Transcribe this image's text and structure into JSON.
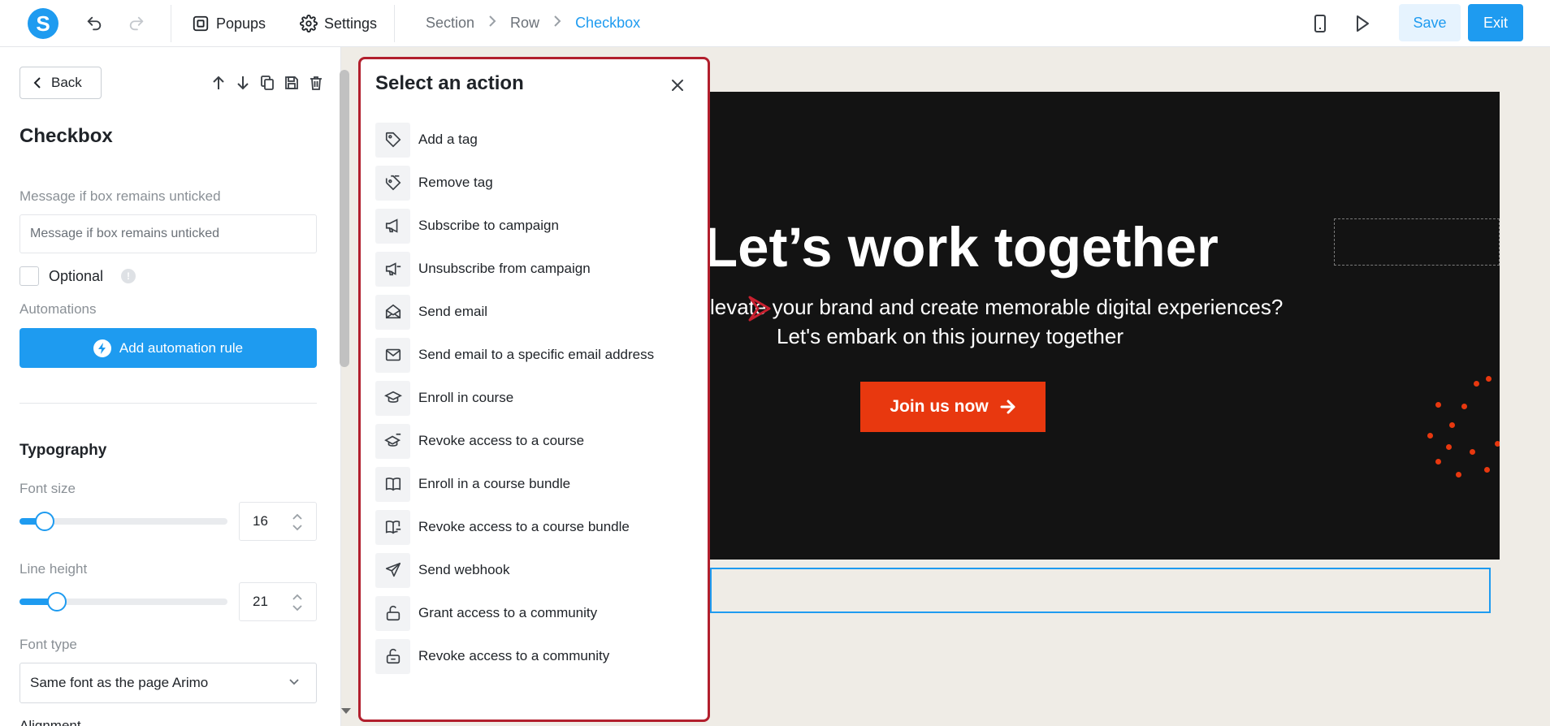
{
  "topbar": {
    "logo_letter": "S",
    "popups_label": "Popups",
    "settings_label": "Settings",
    "breadcrumb": [
      "Section",
      "Row",
      "Checkbox"
    ],
    "save_label": "Save",
    "exit_label": "Exit"
  },
  "left_panel": {
    "back_label": "Back",
    "title": "Checkbox",
    "message_label": "Message if box remains unticked",
    "message_placeholder": "Message if box remains unticked",
    "optional_label": "Optional",
    "info_glyph": "!",
    "automations_label": "Automations",
    "add_automation_label": "Add automation rule",
    "typography_title": "Typography",
    "font_size_label": "Font size",
    "font_size_value": "16",
    "font_size_fraction": 0.12,
    "line_height_label": "Line height",
    "line_height_value": "21",
    "line_height_fraction": 0.18,
    "font_type_label": "Font type",
    "font_type_value": "Same font as the page Arimo",
    "alignment_label": "Alignment"
  },
  "modal": {
    "title": "Select an action",
    "actions": [
      {
        "label": "Add a tag",
        "icon": "tag-icon"
      },
      {
        "label": "Remove tag",
        "icon": "tag-remove-icon"
      },
      {
        "label": "Subscribe to campaign",
        "icon": "megaphone-icon"
      },
      {
        "label": "Unsubscribe from campaign",
        "icon": "megaphone-off-icon"
      },
      {
        "label": "Send email",
        "icon": "envelope-open-icon"
      },
      {
        "label": "Send email to a specific email address",
        "icon": "envelope-icon"
      },
      {
        "label": "Enroll in course",
        "icon": "graduation-cap-icon"
      },
      {
        "label": "Revoke access to a course",
        "icon": "graduation-cap-minus-icon"
      },
      {
        "label": "Enroll in a course bundle",
        "icon": "book-open-icon"
      },
      {
        "label": "Revoke access to a course bundle",
        "icon": "book-minus-icon"
      },
      {
        "label": "Send webhook",
        "icon": "paper-plane-icon"
      },
      {
        "label": "Grant access to a community",
        "icon": "unlock-icon"
      },
      {
        "label": "Revoke access to a community",
        "icon": "lock-minus-icon"
      }
    ]
  },
  "canvas": {
    "hero_title": "Let’s work together",
    "hero_line1": "levate your brand and create memorable digital experiences?",
    "hero_line2": "Let's embark on this journey together",
    "cta_label": "Join us now"
  },
  "colors": {
    "accent": "#1e9bf0",
    "modal_border": "#b21f2d",
    "cta": "#e8380f",
    "hero_bg": "#131313",
    "canvas_bg": "#efece6"
  }
}
